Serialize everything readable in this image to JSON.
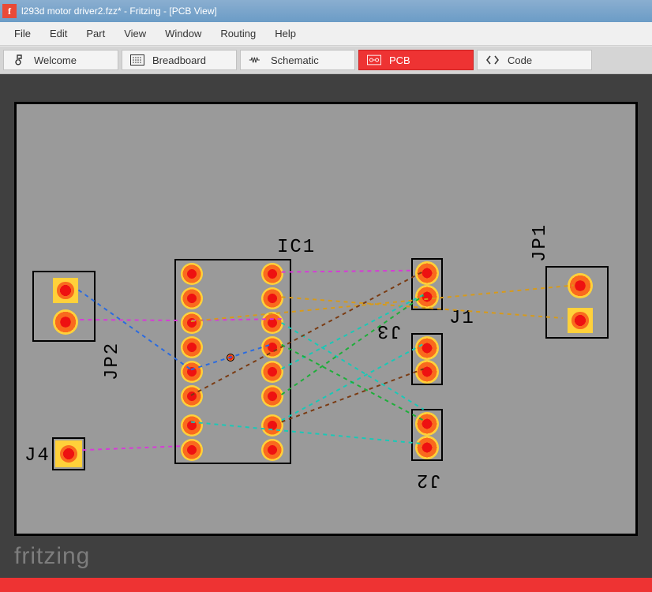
{
  "title": "l293d motor driver2.fzz* - Fritzing - [PCB View]",
  "menu": [
    "File",
    "Edit",
    "Part",
    "View",
    "Window",
    "Routing",
    "Help"
  ],
  "tabs": {
    "welcome": "Welcome",
    "breadboard": "Breadboard",
    "schematic": "Schematic",
    "pcb": "PCB",
    "code": "Code"
  },
  "active_tab": "pcb",
  "labels": {
    "ic1": "IC1",
    "jp1": "JP1",
    "jp2": "JP2",
    "j1": "J1",
    "j2": "J2",
    "j3": "J3",
    "j4": "J4"
  },
  "brand": "fritzing"
}
